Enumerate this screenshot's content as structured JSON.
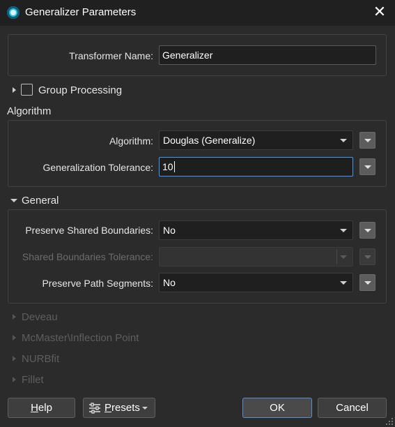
{
  "window": {
    "title": "Generalizer Parameters",
    "close_glyph": "✕"
  },
  "transformer": {
    "label": "Transformer Name:",
    "value": "Generalizer"
  },
  "group_processing": {
    "label": "Group Processing",
    "checked": false
  },
  "algorithm_section": {
    "title": "Algorithm",
    "algorithm": {
      "label": "Algorithm:",
      "value": "Douglas (Generalize)"
    },
    "tolerance": {
      "label": "Generalization Tolerance:",
      "value": "10"
    }
  },
  "general_section": {
    "title": "General",
    "preserve_shared": {
      "label": "Preserve Shared Boundaries:",
      "value": "No"
    },
    "shared_tolerance": {
      "label": "Shared Boundaries Tolerance:",
      "value": ""
    },
    "preserve_path": {
      "label": "Preserve Path Segments:",
      "value": "No"
    }
  },
  "collapsed_sections": [
    "Deveau",
    "McMaster\\Inflection Point",
    "NURBfit",
    "Fillet"
  ],
  "buttons": {
    "help_prefix": "H",
    "help_rest": "elp",
    "presets_prefix": "P",
    "presets_rest": "resets",
    "ok": "OK",
    "cancel": "Cancel"
  },
  "colors": {
    "accent": "#3e9cff",
    "background": "#2b2b2b",
    "titlebar": "#202020"
  }
}
